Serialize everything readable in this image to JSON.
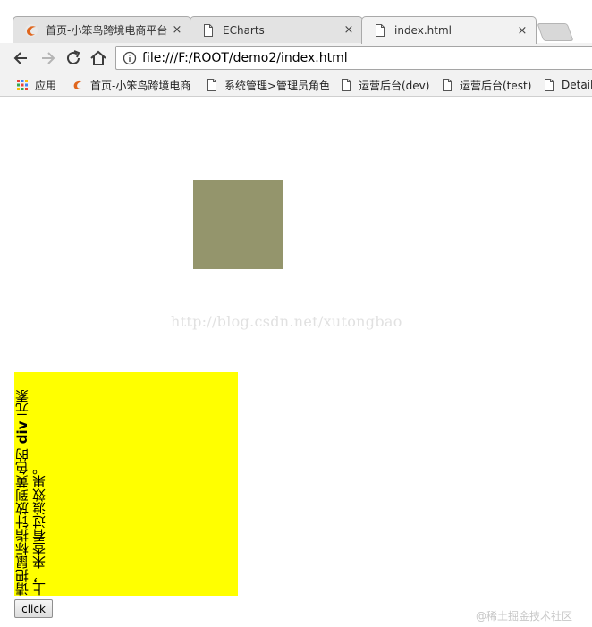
{
  "tabs": [
    {
      "title": "首页-小笨鸟跨境电商平台",
      "icon": "site-bird-icon",
      "close": "×"
    },
    {
      "title": "ECharts",
      "icon": "page-icon",
      "close": "×"
    },
    {
      "title": "index.html",
      "icon": "page-icon",
      "close": "×",
      "active": true
    }
  ],
  "toolbar": {
    "url": "file:///F:/ROOT/demo2/index.html"
  },
  "bookmarks": [
    {
      "label": "应用",
      "icon": "apps-grid-icon"
    },
    {
      "label": "首页-小笨鸟跨境电商",
      "icon": "site-bird-icon"
    },
    {
      "label": "系统管理>管理员角色",
      "icon": "page-icon"
    },
    {
      "label": "运营后台(dev)",
      "icon": "page-icon"
    },
    {
      "label": "运营后台(test)",
      "icon": "page-icon"
    },
    {
      "label": "Detail",
      "icon": "page-icon"
    }
  ],
  "page": {
    "watermark": "http://blog.csdn.net/xutongbao",
    "yellow_text_before": "请把鼠标指针放到黄色的 ",
    "yellow_text_bold": "div",
    "yellow_text_after": " 元素上，来查看过渡效果。",
    "button_label": "click",
    "corner_mark": "@稀土掘金技术社区"
  },
  "colors": {
    "olive_box": "#94956c",
    "yellow_div": "#ffff00"
  }
}
